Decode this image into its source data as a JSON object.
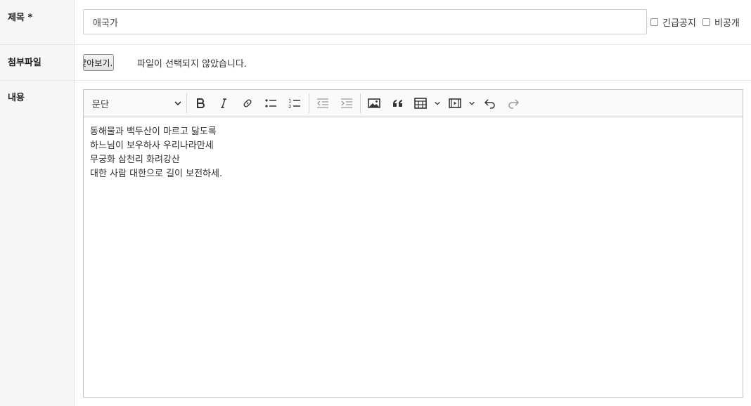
{
  "form": {
    "title_label": "제목 *",
    "title_value": "애국가",
    "urgent_label": "긴급공지",
    "private_label": "비공개",
    "attach_label": "첨부파일",
    "browse_label": "찾아보기...",
    "file_status": "파일이 선택되지 않았습니다.",
    "content_label": "내용"
  },
  "editor": {
    "heading_select": "문단",
    "toolbar_icons": [
      "chevron-down-icon",
      "bold-icon",
      "italic-icon",
      "link-icon",
      "bulleted-list-icon",
      "numbered-list-icon",
      "outdent-icon",
      "indent-icon",
      "image-icon",
      "blockquote-icon",
      "table-icon",
      "media-icon",
      "undo-icon",
      "redo-icon"
    ],
    "lines": [
      "동해물과 백두산이 마르고 닳도록",
      "하느님이 보우하사 우리나라만세",
      "무궁화 삼천리 화려강산",
      "대한 사람 대한으로 길이 보전하세."
    ]
  },
  "colors": {
    "label_bg": "#f7f7f7",
    "border": "#c4c4c4",
    "icon": "#333333",
    "icon_disabled": "#9a9a9a"
  }
}
